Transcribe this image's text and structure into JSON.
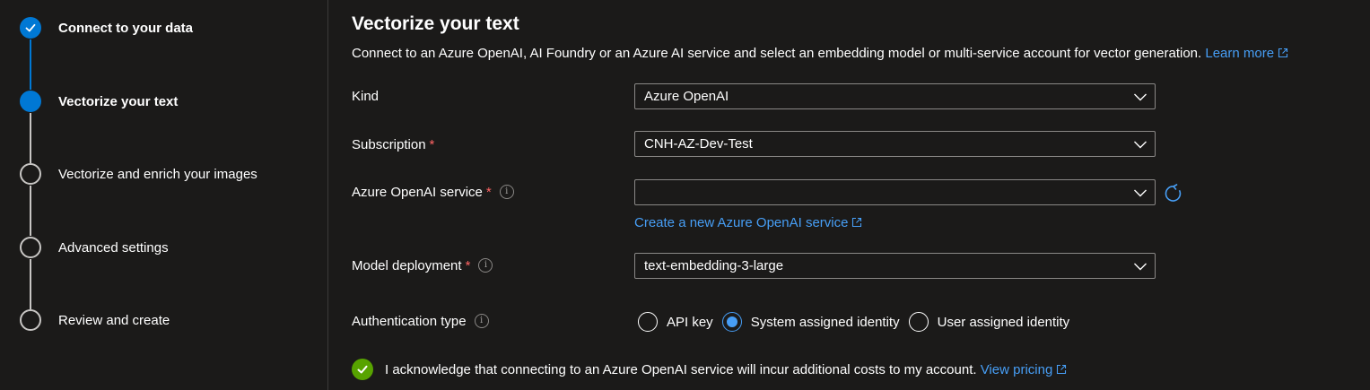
{
  "steps": [
    {
      "label": "Connect to your data",
      "state": "done"
    },
    {
      "label": "Vectorize your text",
      "state": "current"
    },
    {
      "label": "Vectorize and enrich your images",
      "state": "pending"
    },
    {
      "label": "Advanced settings",
      "state": "pending"
    },
    {
      "label": "Review and create",
      "state": "pending"
    }
  ],
  "main": {
    "title": "Vectorize your text",
    "description": "Connect to an Azure OpenAI, AI Foundry or an Azure AI service and select an embedding model or multi-service account for vector generation.",
    "learn_more": "Learn more"
  },
  "fields": {
    "kind": {
      "label": "Kind",
      "value": "Azure OpenAI"
    },
    "subscription": {
      "label": "Subscription",
      "required": "*",
      "value": "CNH-AZ-Dev-Test"
    },
    "openai_service": {
      "label": "Azure OpenAI service",
      "required": "*",
      "value": "",
      "create_link": "Create a new Azure OpenAI service"
    },
    "model_deployment": {
      "label": "Model deployment",
      "required": "*",
      "value": "text-embedding-3-large"
    },
    "auth_type": {
      "label": "Authentication type",
      "options": [
        "API key",
        "System assigned identity",
        "User assigned identity"
      ],
      "selected": "System assigned identity"
    }
  },
  "acknowledgement": {
    "text": "I acknowledge that connecting to an Azure OpenAI service will incur additional costs to my account.",
    "link": "View pricing",
    "checked": true
  },
  "icons": {
    "info": "info-icon",
    "external": "external-link-icon",
    "chevron": "chevron-down-icon",
    "refresh": "refresh-icon",
    "check": "check-icon"
  },
  "colors": {
    "accent": "#0078d4",
    "link": "#479ef5",
    "required": "#ff6464",
    "success": "#57a300",
    "background": "#1b1a19"
  }
}
